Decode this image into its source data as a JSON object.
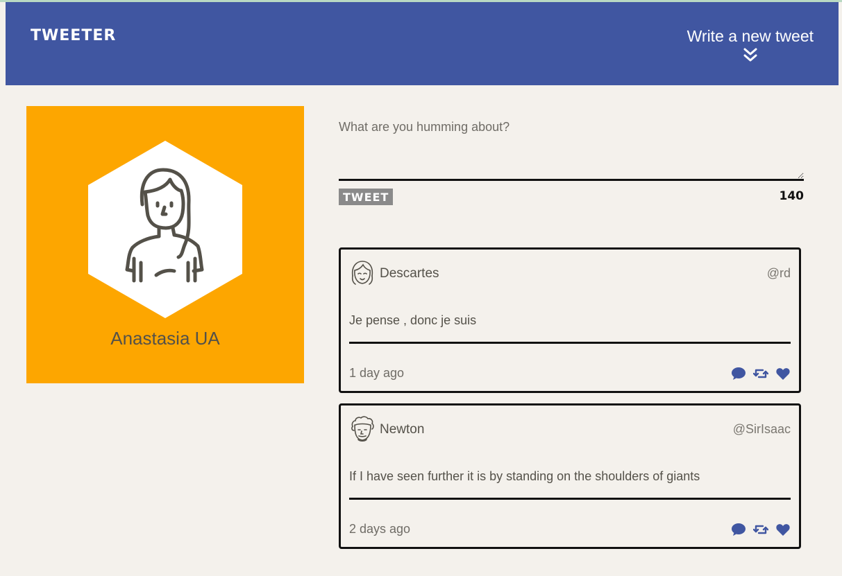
{
  "nav": {
    "brand": "TWEETER",
    "compose_label": "Write a new tweet",
    "compose_icon": "double-chevron-down-icon"
  },
  "profile": {
    "name": "Anastasia UA",
    "avatar_icon": "woman-avatar-icon",
    "background_color": "#fda600"
  },
  "composer": {
    "placeholder": "What are you humming about?",
    "value": "",
    "button_label": "TWEET",
    "char_counter": "140"
  },
  "tweets": [
    {
      "author": "Descartes",
      "handle": "@rd",
      "avatar_icon": "girl-face-avatar-icon",
      "text": "Je pense , donc je suis",
      "time": "1 day ago",
      "actions": [
        "comment-icon",
        "retweet-icon",
        "heart-icon"
      ]
    },
    {
      "author": "Newton",
      "handle": "@SirIsaac",
      "avatar_icon": "curly-hair-face-avatar-icon",
      "text": "If I have seen further it is by standing on the shoulders of giants",
      "time": "2 days ago",
      "actions": [
        "comment-icon",
        "retweet-icon",
        "heart-icon"
      ]
    }
  ],
  "colors": {
    "nav_background": "#4056a1",
    "page_background": "#f4f1ec",
    "accent_icon": "#4056a1",
    "text": "#545149"
  }
}
